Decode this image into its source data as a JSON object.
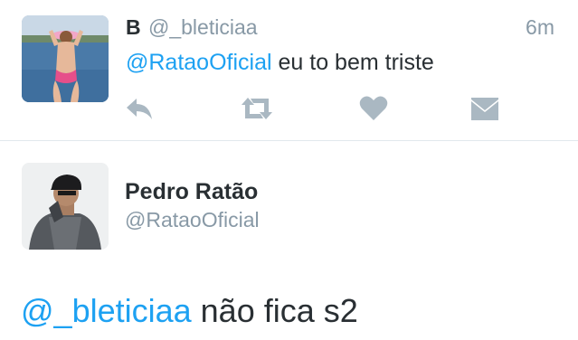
{
  "tweet1": {
    "display_name": "B",
    "handle": "@_bleticiaa",
    "time": "6m",
    "mention": "@RataoOficial",
    "text": " eu to bem triste",
    "actions": {
      "reply_icon": "reply-icon",
      "retweet_icon": "retweet-icon",
      "like_icon": "heart-icon",
      "message_icon": "envelope-icon"
    }
  },
  "tweet2": {
    "display_name": "Pedro Ratão",
    "handle": "@RataoOficial",
    "mention": "@_bleticiaa",
    "text": " não fica s2"
  },
  "colors": {
    "link": "#1da1f2",
    "text": "#292f33",
    "secondary": "#8899a6",
    "icon": "#aab8c2",
    "divider": "#e1e8ed"
  }
}
